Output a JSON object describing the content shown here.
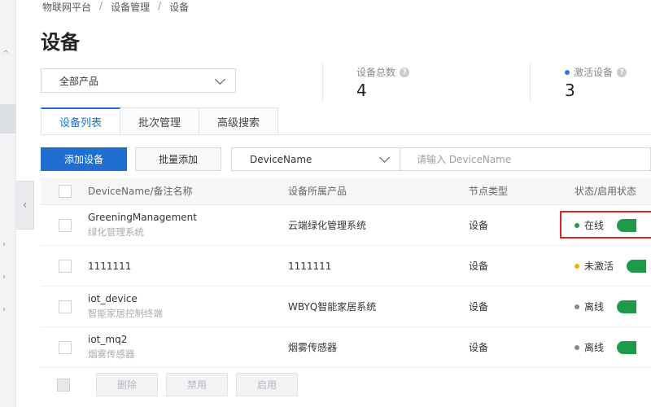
{
  "breadcrumb": [
    "物联网平台",
    "设备管理",
    "设备"
  ],
  "page_title": "设备",
  "product_filter": "全部产品",
  "stats": {
    "total_label": "设备总数",
    "total_value": "4",
    "active_label": "激活设备",
    "active_value": "3"
  },
  "tabs": [
    {
      "label": "设备列表",
      "active": true
    },
    {
      "label": "批次管理",
      "active": false
    },
    {
      "label": "高级搜索",
      "active": false
    }
  ],
  "toolbar": {
    "add_label": "添加设备",
    "batch_add_label": "批量添加",
    "field_select": "DeviceName",
    "search_placeholder": "请输入 DeviceName"
  },
  "table": {
    "headers": [
      "DeviceName/备注名称",
      "设备所属产品",
      "节点类型",
      "状态/启用状态"
    ],
    "rows": [
      {
        "name": "GreeningManagement",
        "alias": "绿化管理系统",
        "product": "云端绿化管理系统",
        "node": "设备",
        "status": "在线",
        "status_color": "#1e9b4a"
      },
      {
        "name": "1111111",
        "alias": "",
        "product": "1111111",
        "node": "设备",
        "status": "未激活",
        "status_color": "#f0b400"
      },
      {
        "name": "iot_device",
        "alias": "智能家居控制终端",
        "product": "WBYQ智能家居系统",
        "node": "设备",
        "status": "离线",
        "status_color": "#888888"
      },
      {
        "name": "iot_mq2",
        "alias": "烟雾传感器",
        "product": "烟雾传感器",
        "node": "设备",
        "status": "离线",
        "status_color": "#888888"
      }
    ]
  },
  "bulk_actions": {
    "delete_label": "删除",
    "disable_label": "禁用",
    "enable_label": "启用"
  },
  "colors": {
    "primary": "#1e6fd0",
    "online": "#1e9b4a",
    "inactive": "#f0b400",
    "offline": "#888888",
    "highlight": "#d92525"
  }
}
